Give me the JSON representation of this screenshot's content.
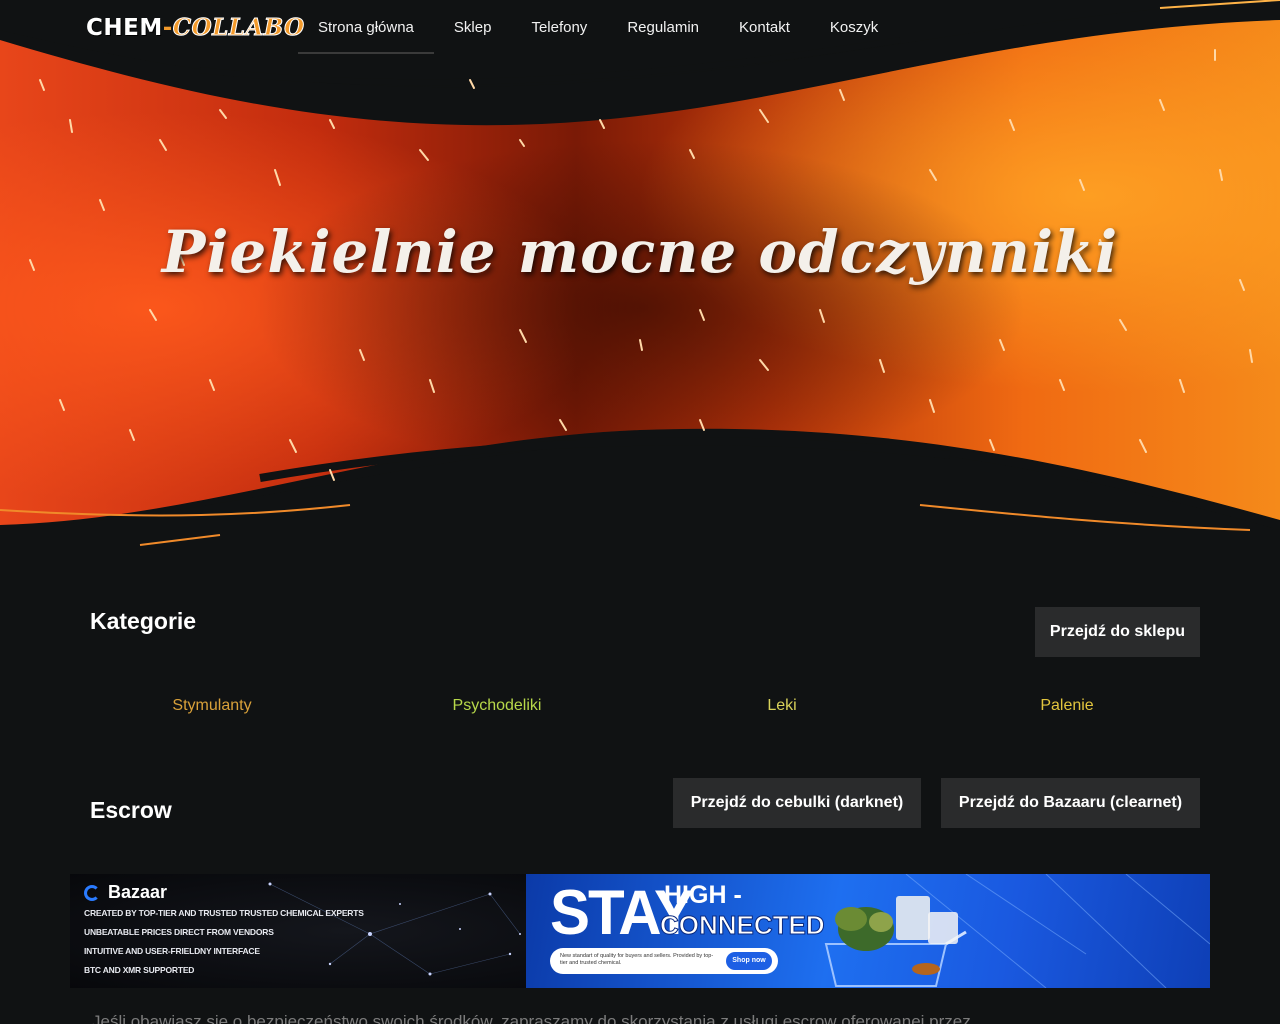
{
  "nav": {
    "logo_part1": "CHEM",
    "logo_dash": "-",
    "logo_part2": "COLLABO",
    "items": [
      {
        "label": "Strona główna",
        "active": true
      },
      {
        "label": "Sklep"
      },
      {
        "label": "Telefony"
      },
      {
        "label": "Regulamin"
      },
      {
        "label": "Kontakt"
      },
      {
        "label": "Koszyk"
      }
    ]
  },
  "hero": {
    "title": "Piekielnie mocne odczynniki"
  },
  "categories": {
    "title": "Kategorie",
    "shop_button": "Przejdź do sklepu",
    "items": [
      {
        "label": "Stymulanty",
        "color": "#d9a13a"
      },
      {
        "label": "Psychodeliki",
        "color": "#b7d84a"
      },
      {
        "label": "Leki",
        "color": "#d8d25a"
      },
      {
        "label": "Palenie",
        "color": "#e2c53e"
      }
    ]
  },
  "escrow": {
    "title": "Escrow",
    "darknet_button": "Przejdź do cebulki (darknet)",
    "clearnet_button": "Przejdź do Bazaaru (clearnet)"
  },
  "banner": {
    "brand": "Bazaar",
    "lines": [
      "CREATED BY TOP-TIER AND TRUSTED TRUSTED CHEMICAL EXPERTS",
      "UNBEATABLE  PRICES DIRECT FROM VENDORS",
      "INTUITIVE AND USER-FRIELDNY INTERFACE",
      "BTC AND XMR SUPPORTED"
    ],
    "stay": "STAY",
    "high": "HIGH -",
    "connected": "CONNECTED",
    "pill_text": "New standart of quality for buyers and sellers. Provided by top-tier and trusted chemical.",
    "shop_now": "Shop now"
  },
  "bottom_text": "Jeśli obawiasz się o bezpieczeństwo swoich środków, zapraszamy do skorzystania z usługi escrow oferowanej przez"
}
